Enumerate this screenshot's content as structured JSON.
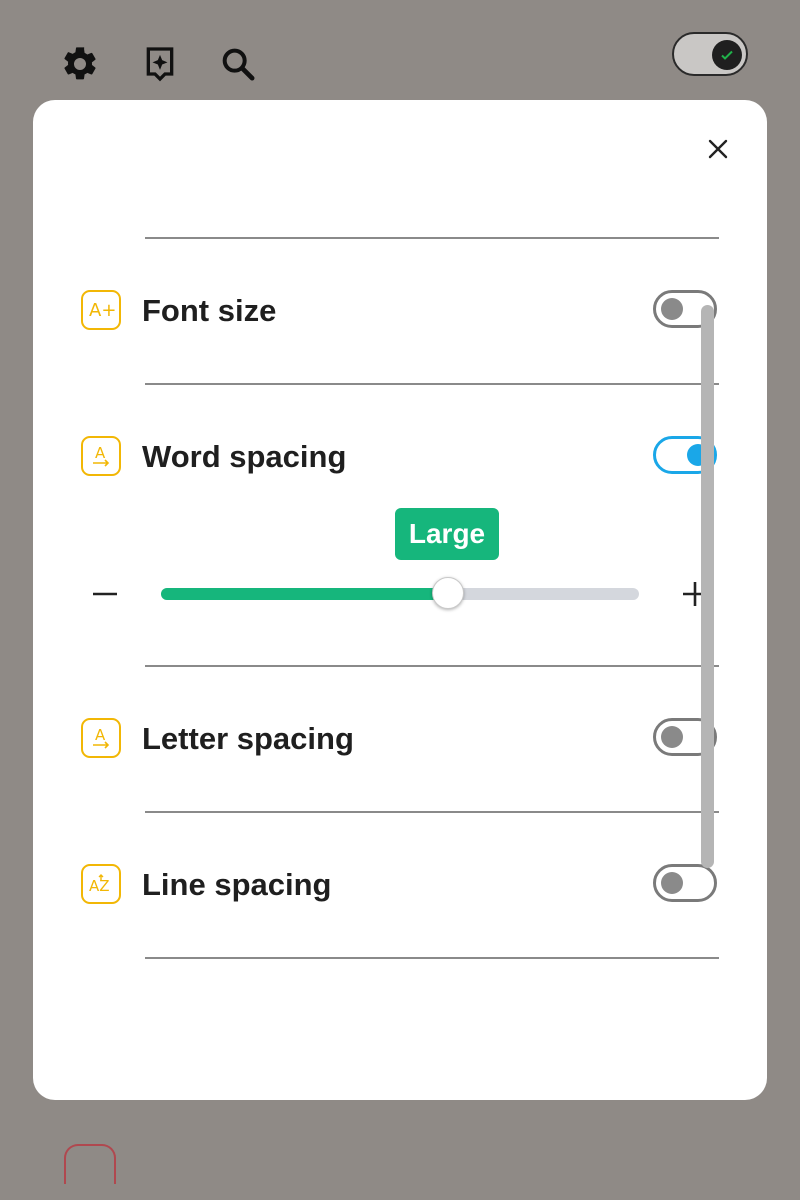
{
  "header": {
    "icons": [
      "gear-icon",
      "sparkle-bookmark-icon",
      "search-icon"
    ],
    "theme_toggle": {
      "state": "on",
      "knob_icon": "check-icon"
    }
  },
  "panel": {
    "close_icon": "close-icon",
    "rows": [
      {
        "label": "Font size",
        "icon": "font-size-plus-icon",
        "icon_text": "A+",
        "enabled": false
      },
      {
        "label": "Word spacing",
        "icon": "word-spacing-icon",
        "icon_text": "A",
        "enabled": true
      },
      {
        "label": "Letter spacing",
        "icon": "letter-spacing-icon",
        "icon_text": "A",
        "enabled": false
      },
      {
        "label": "Line spacing",
        "icon": "line-spacing-icon",
        "icon_text": "AZ",
        "enabled": false
      }
    ],
    "word_spacing_slider": {
      "value_label": "Large",
      "fraction": 0.6,
      "minus_symbol": "−",
      "plus_symbol": "+"
    }
  },
  "colors": {
    "accent_green": "#16b67c",
    "toggle_on": "#1aa7e8",
    "icon_yellow": "#f2b705",
    "backdrop": "#8f8a86"
  }
}
